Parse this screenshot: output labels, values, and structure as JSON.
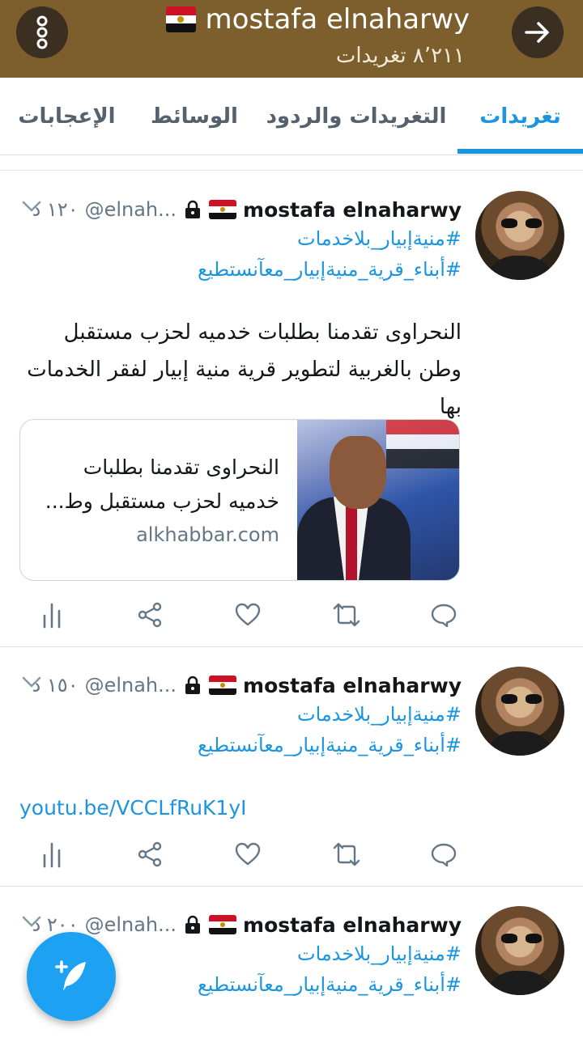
{
  "header": {
    "title": "mostafa elnaharwy",
    "tweet_count": "٨٬٢١١ تغريدات"
  },
  "tabs": [
    {
      "label": "تغريدات",
      "active": true
    },
    {
      "label": "التغريدات والردود",
      "active": false
    },
    {
      "label": "الوسائط",
      "active": false
    },
    {
      "label": "الإعجابات",
      "active": false
    }
  ],
  "colors": {
    "header_bg": "#7d5f2e",
    "accent": "#1b95e0"
  },
  "tweets": [
    {
      "name": "mostafa elnaharwy",
      "handle": "@elnah...",
      "time": "١٢٠ د",
      "hashtags": [
        "#منيةإبيار_بلاخدمات",
        "#أبناء_قرية_منيةإبيار_معآنستطيع"
      ],
      "text": "النحراوى تقدمنا بطلبات خدميه لحزب مستقبل وطن بالغربية لتطوير قرية منية إبيار لفقر الخدمات بها",
      "card": {
        "title": "النحراوى تقدمنا بطلبات خدميه لحزب مستقبل وط...",
        "domain": "alkhabbar.com"
      }
    },
    {
      "name": "mostafa elnaharwy",
      "handle": "@elnah...",
      "time": "١٥٠ د",
      "hashtags": [
        "#منيةإبيار_بلاخدمات",
        "#أبناء_قرية_منيةإبيار_معآنستطيع"
      ],
      "link": "youtu.be/VCCLfRuK1yI"
    },
    {
      "name": "mostafa elnaharwy",
      "handle": "@elnah...",
      "time": "٢٠٠ د",
      "hashtags": [
        "#منيةإبيار_بلاخدمات",
        "#أبناء_قرية_منيةإبيار_معآنستطيع"
      ]
    }
  ]
}
